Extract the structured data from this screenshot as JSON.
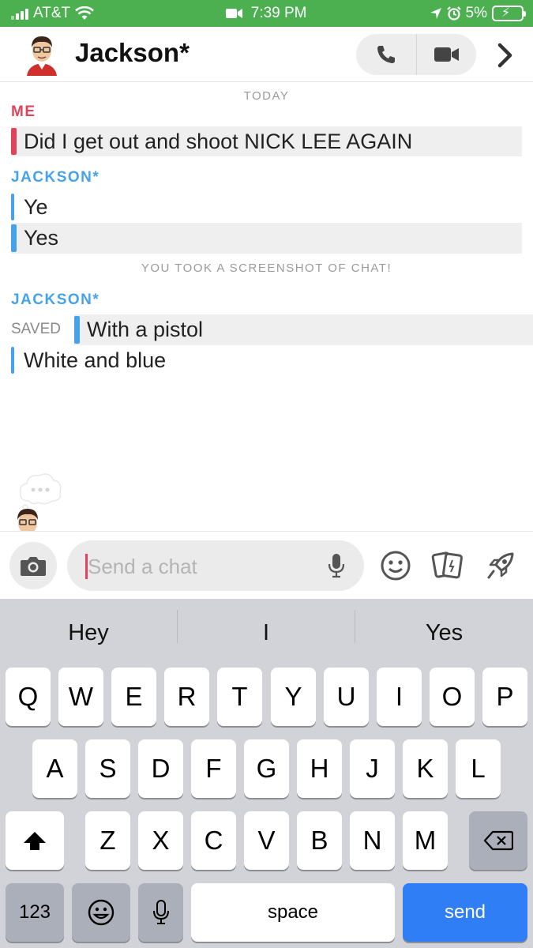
{
  "status_bar": {
    "carrier": "AT&T",
    "time": "7:39 PM",
    "battery": "5%"
  },
  "header": {
    "contact_name": "Jackson*"
  },
  "chat": {
    "date_separator": "TODAY",
    "sender_me": "ME",
    "sender_them": "JACKSON*",
    "screenshot_notice": "YOU TOOK A SCREENSHOT OF CHAT!",
    "saved_label": "SAVED",
    "messages": [
      {
        "sender": "me",
        "text": "Did I get out and shoot NICK LEE AGAIN",
        "highlighted": true
      },
      {
        "sender": "them",
        "text": "Ye",
        "highlighted": false
      },
      {
        "sender": "them",
        "text": "Yes",
        "highlighted": true
      },
      {
        "sender": "them",
        "text": "With a pistol",
        "highlighted": true,
        "saved": true
      },
      {
        "sender": "them",
        "text": "White and blue",
        "highlighted": false
      }
    ]
  },
  "input": {
    "placeholder": "Send a chat"
  },
  "keyboard": {
    "suggestions": [
      "Hey",
      "I",
      "Yes"
    ],
    "row1": [
      "Q",
      "W",
      "E",
      "R",
      "T",
      "Y",
      "U",
      "I",
      "O",
      "P"
    ],
    "row2": [
      "A",
      "S",
      "D",
      "F",
      "G",
      "H",
      "J",
      "K",
      "L"
    ],
    "row3": [
      "Z",
      "X",
      "C",
      "V",
      "B",
      "N",
      "M"
    ],
    "numbers_key": "123",
    "space_key": "space",
    "send_key": "send"
  },
  "colors": {
    "status_bar": "#4cb050",
    "me": "#e1435a",
    "them": "#46a3e9",
    "send_key": "#2f7ef6"
  },
  "icons": [
    "signal-icon",
    "wifi-icon",
    "video-status-icon",
    "location-icon",
    "alarm-icon",
    "battery-icon",
    "phone-icon",
    "video-call-icon",
    "chevron-right-icon",
    "camera-icon",
    "microphone-icon",
    "smiley-icon",
    "cards-icon",
    "rocket-icon",
    "shift-icon",
    "backspace-icon",
    "emoji-icon"
  ]
}
